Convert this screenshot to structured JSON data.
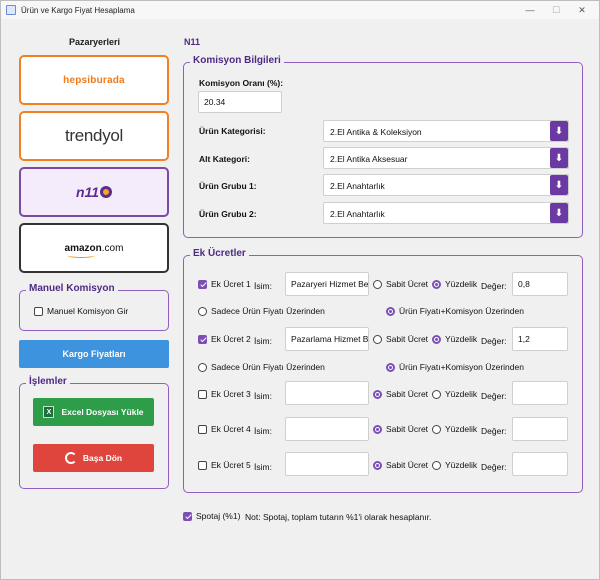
{
  "window": {
    "title": "Ürün ve Kargo Fiyat Hesaplama",
    "minimize": "—",
    "maximize": "☐",
    "close": "✕"
  },
  "sidebar": {
    "marketplaces_title": "Pazaryerleri",
    "marketplaces": [
      {
        "name": "hepsiburada",
        "logo": "hepsiburada"
      },
      {
        "name": "trendyol",
        "logo": "trendyol"
      },
      {
        "name": "n11",
        "logo": "n11"
      },
      {
        "name": "amazon",
        "logo": "amazon",
        "logo_suffix": ".com"
      }
    ],
    "manual": {
      "title": "Manuel Komisyon",
      "checkbox_label": "Manuel Komisyon Gir",
      "checked": false
    },
    "cargo_button": "Kargo Fiyatları",
    "actions": {
      "title": "İşlemler",
      "excel_button": "Excel Dosyası Yükle",
      "reset_button": "Başa Dön"
    }
  },
  "main": {
    "selected_marketplace": "N11",
    "commission": {
      "title": "Komisyon Bilgileri",
      "rate_label": "Komisyon Oranı (%):",
      "rate_value": "20.34",
      "category_label": "Ürün Kategorisi:",
      "category_value": "2.El Antika & Koleksiyon",
      "subcategory_label": "Alt Kategori:",
      "subcategory_value": "2.El Antika Aksesuar",
      "group1_label": "Ürün Grubu 1:",
      "group1_value": "2.El Anahtarlık",
      "group2_label": "Ürün Grubu 2:",
      "group2_value": "2.El Anahtarlık"
    },
    "extra_fees": {
      "title": "Ek Ücretler",
      "name_label": "İsim:",
      "fixed_label": "Sabit Ücret",
      "percent_label": "Yüzdelik",
      "value_label": "Değer:",
      "base_product_label": "Sadece Ürün Fiyatı Üzerinden",
      "base_total_label": "Ürün Fiyatı+Komisyon Üzerinden",
      "fees": [
        {
          "label": "Ek Ücret 1",
          "checked": true,
          "name": "Pazaryeri Hizmet Bedeli",
          "mode": "percent",
          "value": "0,8",
          "base": "total"
        },
        {
          "label": "Ek Ücret 2",
          "checked": true,
          "name": "Pazarlama Hizmet Bedeli",
          "mode": "percent",
          "value": "1,2",
          "base": "total"
        },
        {
          "label": "Ek Ücret 3",
          "checked": false,
          "name": "",
          "mode": "fixed",
          "value": ""
        },
        {
          "label": "Ek Ücret 4",
          "checked": false,
          "name": "",
          "mode": "fixed",
          "value": ""
        },
        {
          "label": "Ek Ücret 5",
          "checked": false,
          "name": "",
          "mode": "fixed",
          "value": ""
        }
      ]
    },
    "spotaj": {
      "label": "Spotaj (%1)",
      "checked": true,
      "note": "Not: Spotaj, toplam tutarın %1'i olarak hesaplanır."
    }
  },
  "colors": {
    "accent": "#7b4fb3",
    "group_border": "#8e5fc0",
    "blue_button": "#3d93de",
    "green_button": "#2e9d49",
    "red_button": "#e0453d",
    "hepsiburada": "#f27a1a"
  }
}
